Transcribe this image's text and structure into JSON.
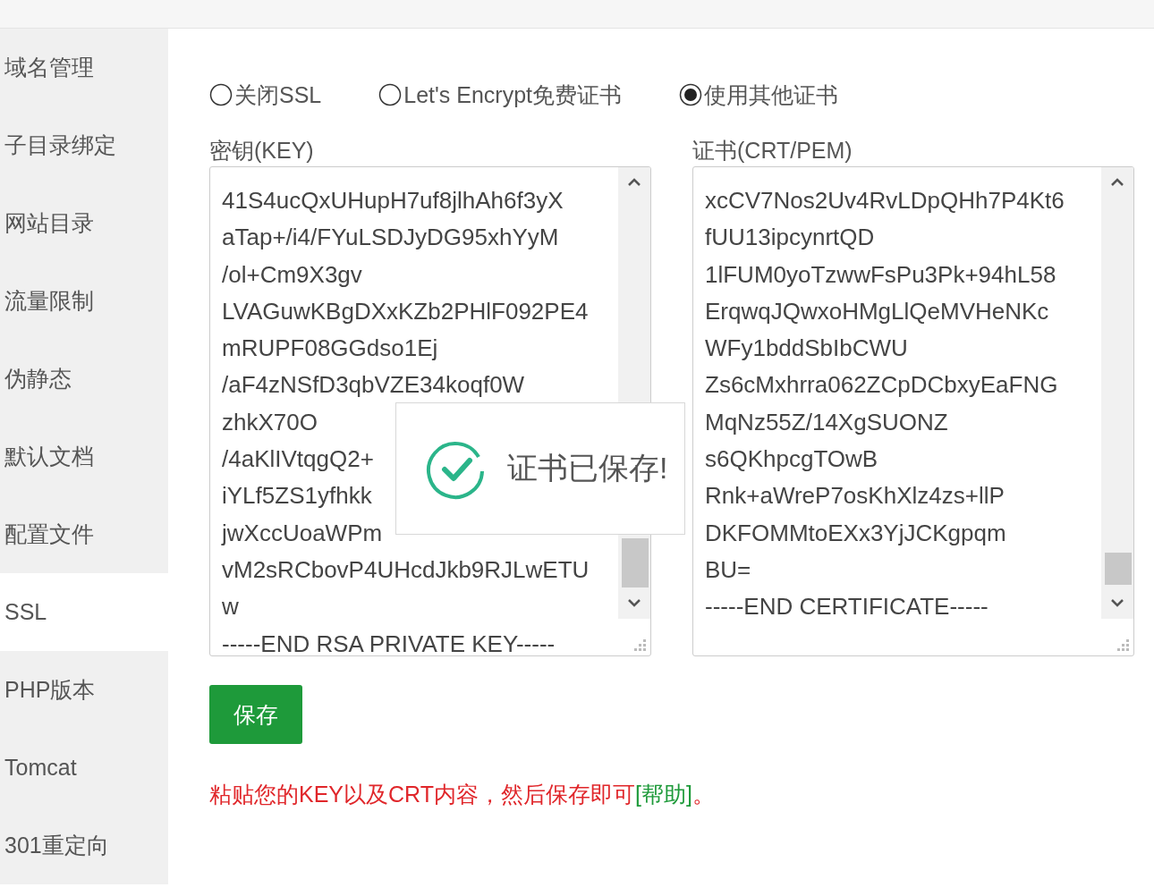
{
  "sidebar": {
    "items": [
      {
        "label": "域名管理",
        "selected": false
      },
      {
        "label": "子目录绑定",
        "selected": false
      },
      {
        "label": "网站目录",
        "selected": false
      },
      {
        "label": "流量限制",
        "selected": false
      },
      {
        "label": "伪静态",
        "selected": false
      },
      {
        "label": "默认文档",
        "selected": false
      },
      {
        "label": "配置文件",
        "selected": false
      },
      {
        "label": "SSL",
        "selected": true
      },
      {
        "label": "PHP版本",
        "selected": false
      },
      {
        "label": "Tomcat",
        "selected": false
      },
      {
        "label": "301重定向",
        "selected": false
      }
    ]
  },
  "ssl_options": [
    {
      "label": "关闭SSL",
      "selected": false
    },
    {
      "label": "Let's Encrypt免费证书",
      "selected": false
    },
    {
      "label": "使用其他证书",
      "selected": true
    }
  ],
  "fields": [
    {
      "label": "密钥(KEY)",
      "lines": [
        "41S4ucQxUHupH7uf8jlhAh6f3yX",
        "aTap+/i4/FYuLSDJyDG95xhYyM",
        "/ol+Cm9X3gv",
        "LVAGuwKBgDXxKZb2PHlF092PE4",
        "mRUPF08GGdso1Ej",
        "/aF4zNSfD3qbVZE34koqf0W",
        "zhkX70O",
        "/4aKlIVtqgQ2+",
        "iYLf5ZS1yfhkk",
        "jwXccUoaWPm",
        "vM2sRCbovP4UHcdJkb9RJLwETU",
        "w",
        "-----END RSA PRIVATE KEY-----"
      ]
    },
    {
      "label": "证书(CRT/PEM)",
      "lines": [
        "xcCV7Nos2Uv4RvLDpQHh7P4Kt6",
        "fUU13ipcynrtQD",
        "1lFUM0yoTzwwFsPu3Pk+94hL58",
        "ErqwqJQwxoHMgLlQeMVHeNKc",
        "WFy1bddSbIbCWU",
        "Zs6cMxhrra062ZCpDCbxyEaFNG",
        "MqNz55Z/14XgSUONZ",
        "s6QKhpcgTOwB",
        "Rnk+aWreP7osKhXlz4zs+llP",
        "DKFOMMtoEXx3YjJCKgpqm",
        "BU=",
        "-----END CERTIFICATE-----"
      ]
    }
  ],
  "save_button": "保存",
  "note": {
    "text": "粘贴您的KEY以及CRT内容，然后保存即可",
    "link": "[帮助]",
    "end": "。"
  },
  "toast": {
    "message": "证书已保存!"
  }
}
